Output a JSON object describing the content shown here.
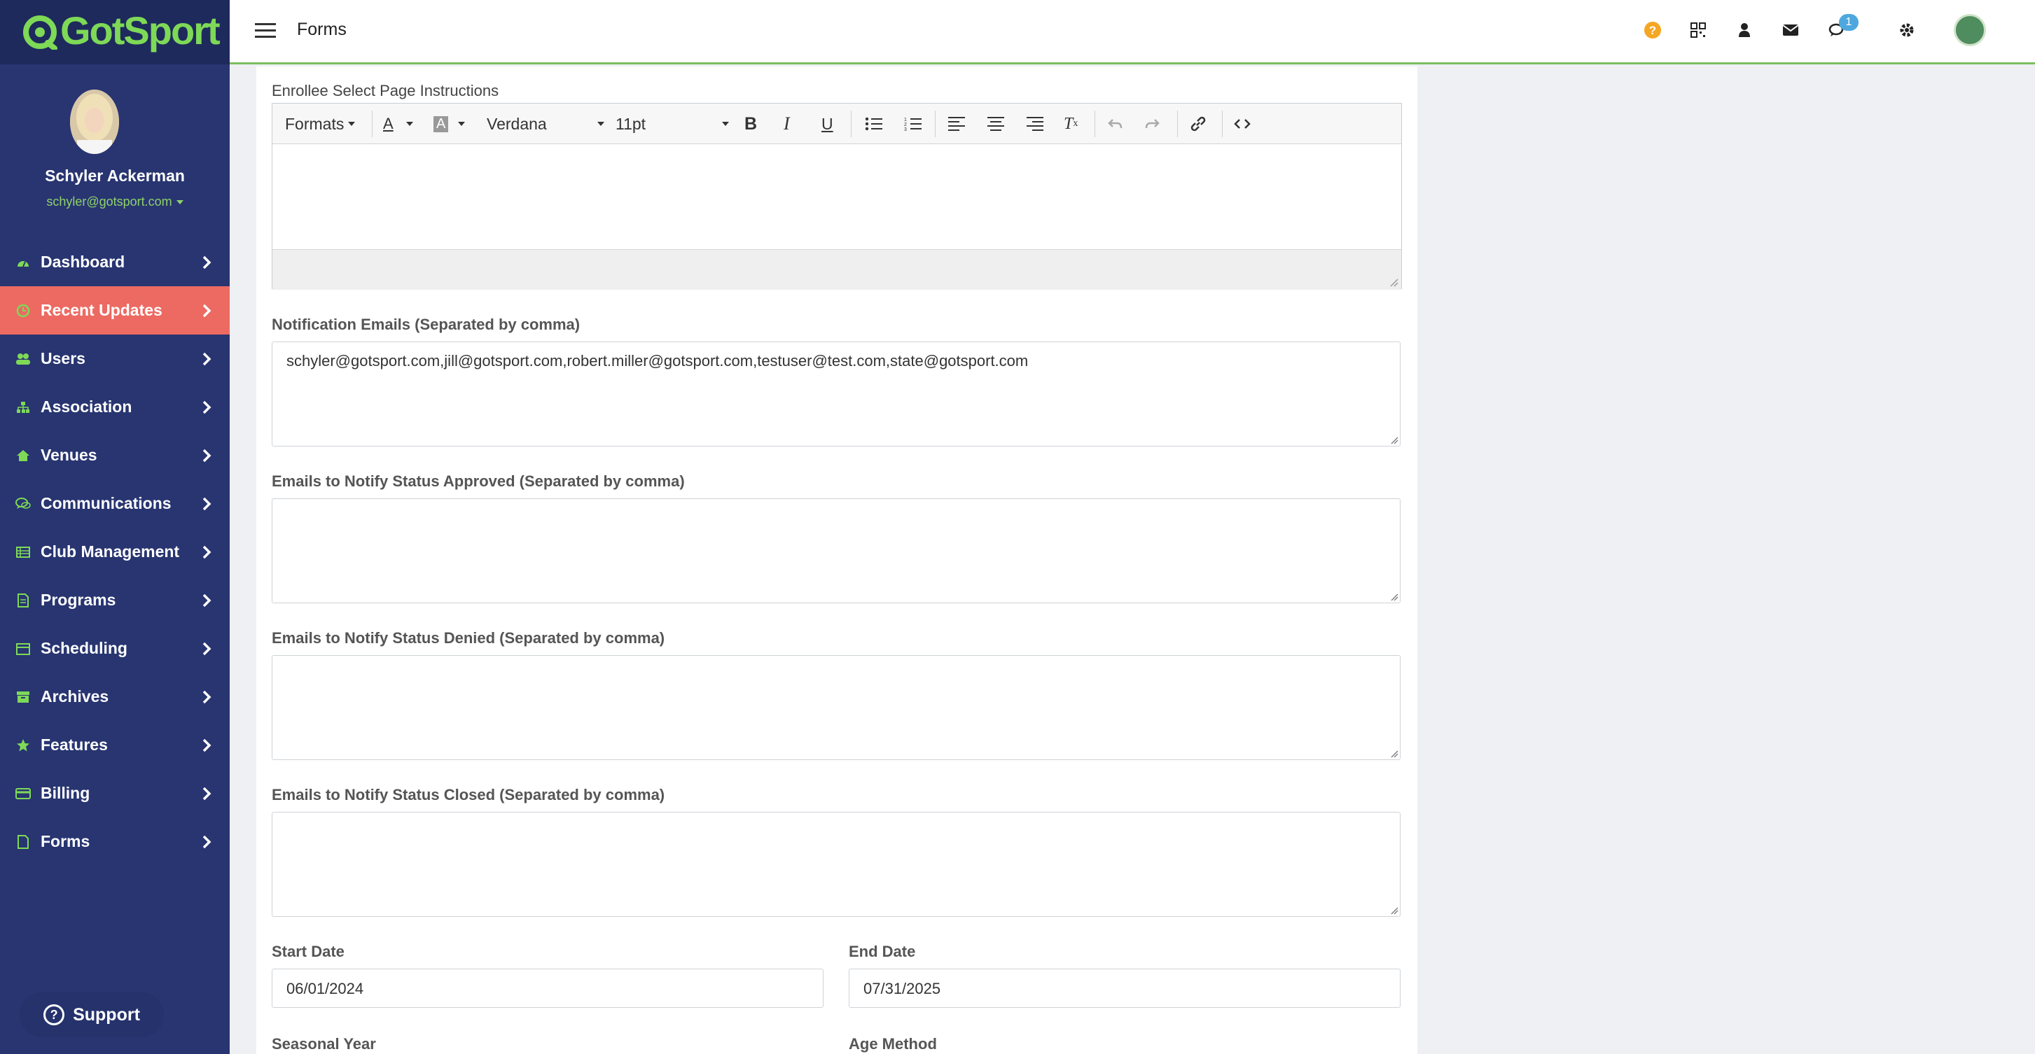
{
  "app": {
    "brand": "GotSport",
    "accent": "#7ed957",
    "sidebar_bg": "#283571",
    "active_bg": "#ec6a62"
  },
  "user": {
    "name": "Schyler Ackerman",
    "email": "schyler@gotsport.com"
  },
  "sidebar": {
    "items": [
      {
        "label": "Dashboard",
        "icon": "dashboard-icon"
      },
      {
        "label": "Recent Updates",
        "icon": "updates-icon",
        "active": true
      },
      {
        "label": "Users",
        "icon": "users-icon"
      },
      {
        "label": "Association",
        "icon": "sitemap-icon"
      },
      {
        "label": "Venues",
        "icon": "home-icon"
      },
      {
        "label": "Communications",
        "icon": "chat-icon"
      },
      {
        "label": "Club Management",
        "icon": "list-icon"
      },
      {
        "label": "Programs",
        "icon": "file-icon"
      },
      {
        "label": "Scheduling",
        "icon": "calendar-icon"
      },
      {
        "label": "Archives",
        "icon": "archive-icon"
      },
      {
        "label": "Features",
        "icon": "star-icon"
      },
      {
        "label": "Billing",
        "icon": "credit-card-icon"
      },
      {
        "label": "Forms",
        "icon": "document-icon"
      }
    ],
    "support_label": "Support"
  },
  "topbar": {
    "title": "Forms",
    "chat_badge": "1"
  },
  "editor": {
    "label": "Enrollee Select Page Instructions",
    "formats_label": "Formats",
    "font_family": "Verdana",
    "font_size": "11pt",
    "text_color_glyph": "A",
    "bg_color_glyph": "A"
  },
  "form": {
    "notification_emails": {
      "label": "Notification Emails (Separated by comma)",
      "value": "schyler@gotsport.com,jill@gotsport.com,robert.miller@gotsport.com,testuser@test.com,state@gotsport.com"
    },
    "approved_emails": {
      "label": "Emails to Notify Status Approved (Separated by comma)",
      "value": ""
    },
    "denied_emails": {
      "label": "Emails to Notify Status Denied (Separated by comma)",
      "value": ""
    },
    "closed_emails": {
      "label": "Emails to Notify Status Closed (Separated by comma)",
      "value": ""
    },
    "start_date": {
      "label": "Start Date",
      "value": "06/01/2024"
    },
    "end_date": {
      "label": "End Date",
      "value": "07/31/2025"
    },
    "seasonal_year": {
      "label": "Seasonal Year"
    },
    "age_method": {
      "label": "Age Method"
    }
  }
}
